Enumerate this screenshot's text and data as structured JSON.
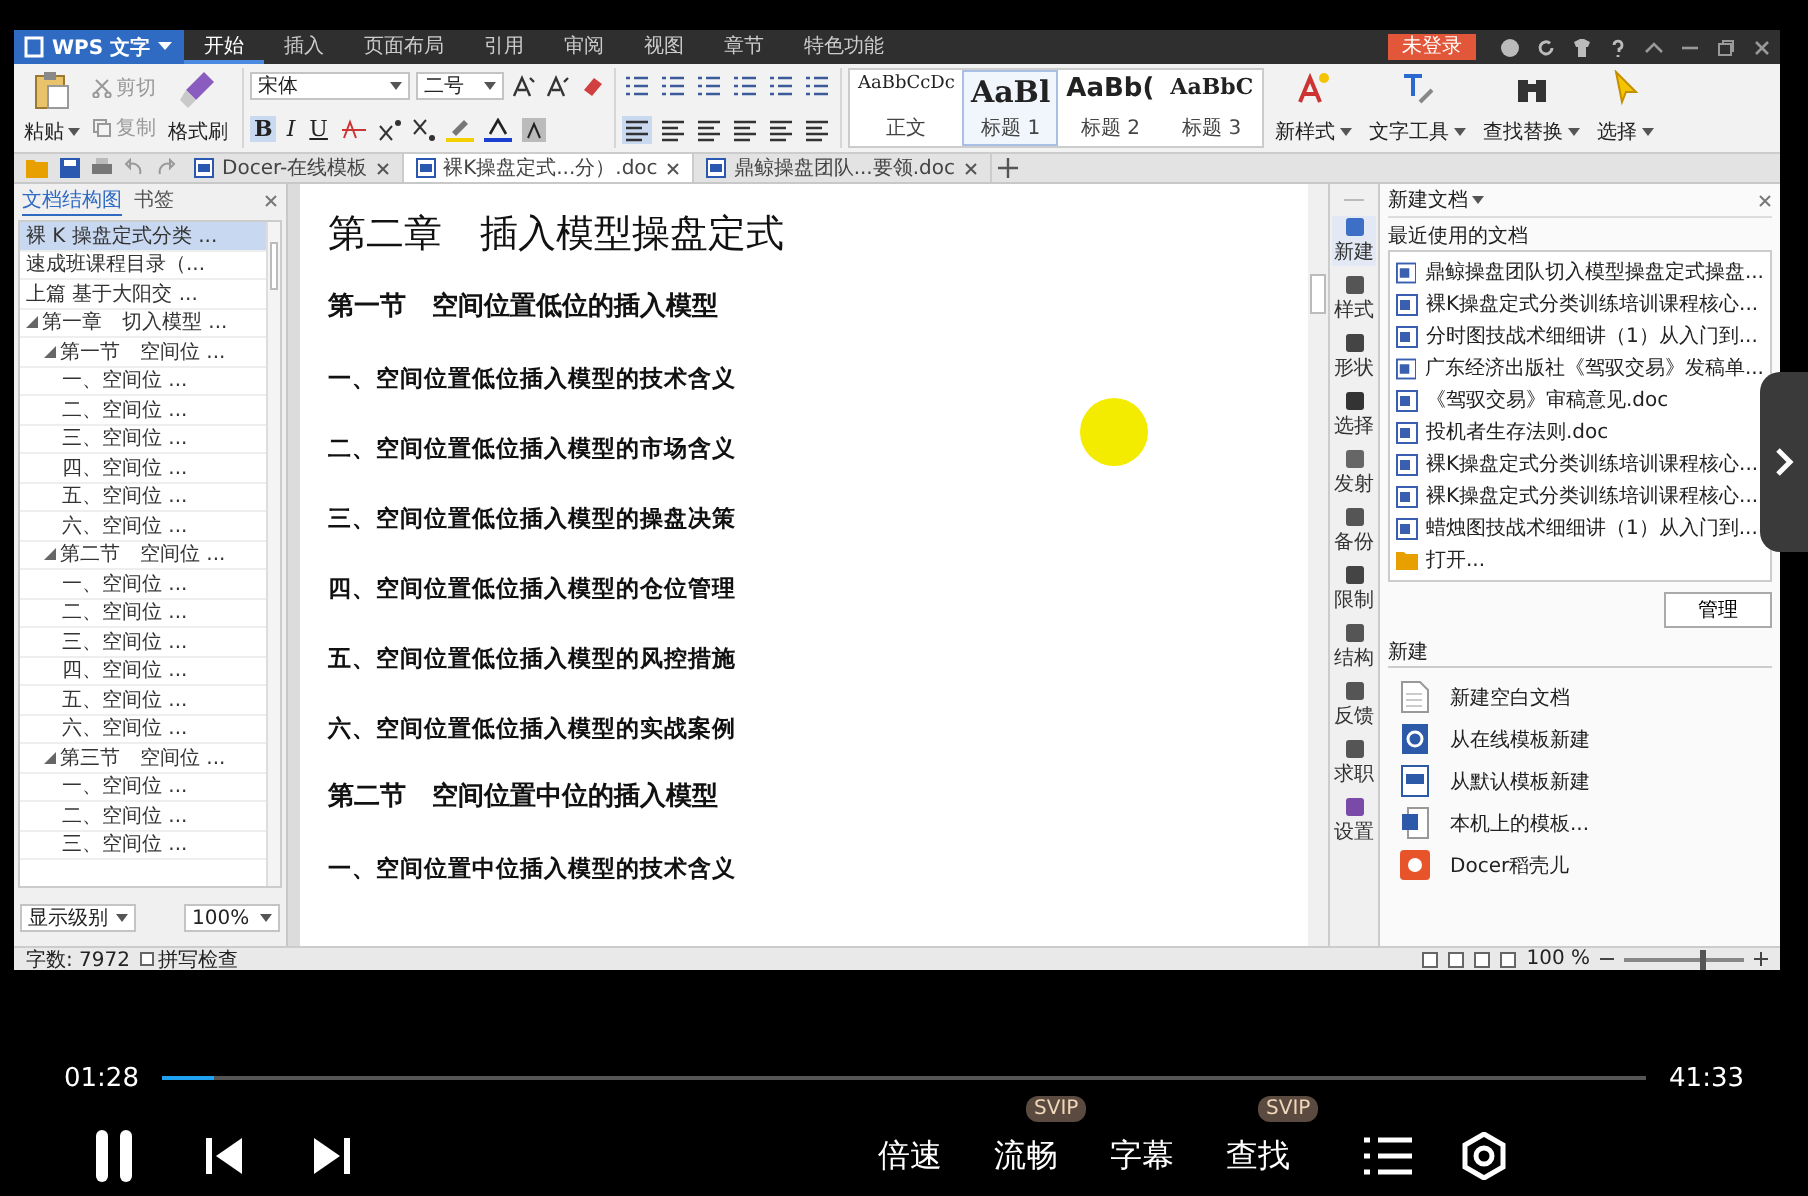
{
  "app": {
    "logo": "WPS 文字",
    "login": "未登录",
    "menu": [
      {
        "label": "开始",
        "selected": true
      },
      {
        "label": "插入",
        "selected": false
      },
      {
        "label": "页面布局",
        "selected": false
      },
      {
        "label": "引用",
        "selected": false
      },
      {
        "label": "审阅",
        "selected": false
      },
      {
        "label": "视图",
        "selected": false
      },
      {
        "label": "章节",
        "selected": false
      },
      {
        "label": "特色功能",
        "selected": false
      }
    ]
  },
  "ribbon": {
    "paste": "粘贴",
    "cut": "剪切",
    "copy": "复制",
    "format_painter": "格式刷",
    "font": "宋体",
    "size": "二号",
    "format_buttons": [
      "B",
      "I",
      "U"
    ],
    "styles": [
      {
        "sample": "AaBbCcDc",
        "label": "正文",
        "selected": false
      },
      {
        "sample": "AaBl",
        "label": "标题 1",
        "selected": true
      },
      {
        "sample": "AaBb(",
        "label": "标题 2",
        "selected": false
      },
      {
        "sample": "AaBbC",
        "label": "标题 3",
        "selected": false
      }
    ],
    "new_style": "新样式",
    "text_tools": "文字工具",
    "find_replace": "查找替换",
    "select": "选择"
  },
  "tabs": [
    {
      "label": "Docer-在线模板",
      "selected": false
    },
    {
      "label": "裸K操盘定式...分）.doc",
      "selected": true
    },
    {
      "label": "鼎鲸操盘团队...要领.doc",
      "selected": false
    }
  ],
  "nav": {
    "tabs": [
      {
        "label": "文档结构图",
        "selected": true
      },
      {
        "label": "书签",
        "selected": false
      }
    ],
    "tree": [
      {
        "label": "裸 K 操盘定式分类 ...",
        "selected": true
      },
      {
        "label": "速成班课程目录（...",
        "selected": false
      },
      {
        "label": "上篇 基于大阳交 ...",
        "selected": false
      },
      {
        "label": "第一章　切入模型 ...",
        "selected": false,
        "expanded": true,
        "children": [
          {
            "label": "第一节　空间位 ...",
            "selected": false,
            "expanded": true,
            "children": [
              {
                "label": "一、空间位 ...",
                "selected": false
              },
              {
                "label": "二、空间位 ...",
                "selected": false
              },
              {
                "label": "三、空间位 ...",
                "selected": false
              },
              {
                "label": "四、空间位 ...",
                "selected": false
              },
              {
                "label": "五、空间位 ...",
                "selected": false
              },
              {
                "label": "六、空间位 ...",
                "selected": false
              }
            ]
          },
          {
            "label": "第二节　空间位 ...",
            "selected": false,
            "expanded": true,
            "children": [
              {
                "label": "一、空间位 ...",
                "selected": false
              },
              {
                "label": "二、空间位 ...",
                "selected": false
              },
              {
                "label": "三、空间位 ...",
                "selected": false
              },
              {
                "label": "四、空间位 ...",
                "selected": false
              },
              {
                "label": "五、空间位 ...",
                "selected": false
              },
              {
                "label": "六、空间位 ...",
                "selected": false
              }
            ]
          },
          {
            "label": "第三节　空间位 ...",
            "selected": false,
            "expanded": true,
            "children": [
              {
                "label": "一、空间位 ...",
                "selected": false
              },
              {
                "label": "二、空间位 ...",
                "selected": false
              },
              {
                "label": "三、空间位 ...",
                "selected": false
              }
            ]
          }
        ]
      }
    ],
    "level_button": "显示级别",
    "zoom": "100%"
  },
  "document": {
    "paragraphs": [
      {
        "kind": "chapter",
        "text": "第二章　插入模型操盘定式"
      },
      {
        "kind": "section",
        "text": "第一节　空间位置低位的插入模型"
      },
      {
        "kind": "item",
        "text": "一、空间位置低位插入模型的技术含义"
      },
      {
        "kind": "item",
        "text": "二、空间位置低位插入模型的市场含义"
      },
      {
        "kind": "item",
        "text": "三、空间位置低位插入模型的操盘决策"
      },
      {
        "kind": "item",
        "text": "四、空间位置低位插入模型的仓位管理"
      },
      {
        "kind": "item",
        "text": "五、空间位置低位插入模型的风控措施"
      },
      {
        "kind": "item",
        "text": "六、空间位置低位插入模型的实战案例"
      },
      {
        "kind": "section",
        "text": "第二节　空间位置中位的插入模型"
      },
      {
        "kind": "item",
        "text": "一、空间位置中位插入模型的技术含义"
      }
    ]
  },
  "side_strip": [
    {
      "kind": "new",
      "label": "新建",
      "selected": true
    },
    {
      "kind": "style",
      "label": "样式",
      "selected": false
    },
    {
      "kind": "shape",
      "label": "形状",
      "selected": false
    },
    {
      "kind": "select",
      "label": "选择",
      "selected": false
    },
    {
      "kind": "send",
      "label": "发射",
      "selected": false
    },
    {
      "kind": "backup",
      "label": "备份",
      "selected": false
    },
    {
      "kind": "limit",
      "label": "限制",
      "selected": false
    },
    {
      "kind": "structure",
      "label": "结构",
      "selected": false
    },
    {
      "kind": "feedback",
      "label": "反馈",
      "selected": false
    },
    {
      "kind": "job",
      "label": "求职",
      "selected": false
    },
    {
      "kind": "settings",
      "label": "设置",
      "selected": false
    }
  ],
  "task_pane": {
    "title": "新建文档",
    "recent_heading": "最近使用的文档",
    "recent": [
      {
        "kind": "doc",
        "label": "鼎鲸操盘团队切入模型操盘定式操盘..."
      },
      {
        "kind": "doc",
        "label": "裸K操盘定式分类训练培训课程核心..."
      },
      {
        "kind": "doc",
        "label": "分时图技战术细细讲（1）从入门到..."
      },
      {
        "kind": "doc",
        "label": "广东经济出版社《驾驭交易》发稿单..."
      },
      {
        "kind": "doc",
        "label": "《驾驭交易》审稿意见.doc"
      },
      {
        "kind": "doc",
        "label": "投机者生存法则.doc"
      },
      {
        "kind": "doc",
        "label": "裸K操盘定式分类训练培训课程核心..."
      },
      {
        "kind": "doc",
        "label": "裸K操盘定式分类训练培训课程核心..."
      },
      {
        "kind": "doc",
        "label": "蜡烛图技战术细细讲（1）从入门到..."
      },
      {
        "kind": "open",
        "label": "打开..."
      }
    ],
    "manage": "管理",
    "new_heading": "新建",
    "new_items": [
      {
        "kind": "blank",
        "label": "新建空白文档"
      },
      {
        "kind": "online",
        "label": "从在线模板新建"
      },
      {
        "kind": "default",
        "label": "从默认模板新建"
      },
      {
        "kind": "local",
        "label": "本机上的模板..."
      },
      {
        "kind": "docer",
        "label": "Docer稻壳儿"
      }
    ]
  },
  "status_bar": {
    "word_count": "字数: 7972",
    "spell_check": {
      "label": "拼写检查",
      "checked": false
    },
    "zoom": "100 %",
    "zoom_slider": {
      "level": 0.64
    }
  },
  "player": {
    "playing": true,
    "elapsed": "01:28",
    "total": "41:33",
    "level": 0.035,
    "options": [
      {
        "label": "倍速"
      },
      {
        "label": "流畅",
        "badge": "SVIP"
      },
      {
        "label": "字幕"
      },
      {
        "label": "查找",
        "badge": "SVIP"
      }
    ]
  }
}
